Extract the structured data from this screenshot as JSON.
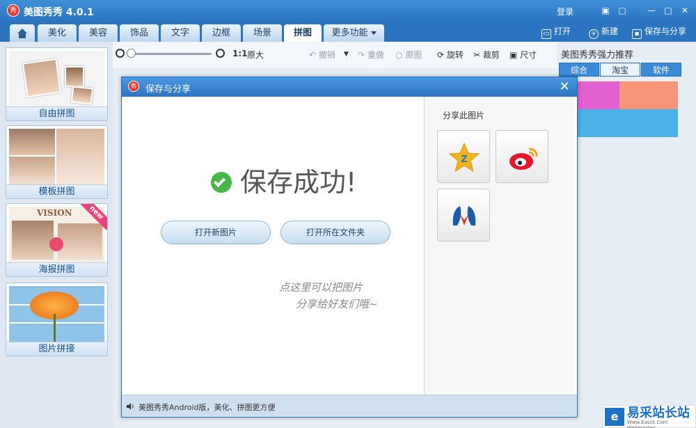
{
  "app": {
    "title": "美图秀秀 4.0.1",
    "logo_char": "秀",
    "login": "登录"
  },
  "tabs": [
    {
      "label": "美化"
    },
    {
      "label": "美容"
    },
    {
      "label": "饰品"
    },
    {
      "label": "文字"
    },
    {
      "label": "边框"
    },
    {
      "label": "场景"
    },
    {
      "label": "拼图",
      "active": true
    },
    {
      "label": "更多功能"
    }
  ],
  "actions": {
    "open": "打开",
    "new": "新建",
    "save_share": "保存与分享"
  },
  "toolbar": {
    "ratio": "1:1",
    "original_size": "原大",
    "undo": "撤销",
    "redo": "重做",
    "original": "原图",
    "rotate": "旋转",
    "crop": "裁剪",
    "size": "尺寸"
  },
  "left_cards": [
    {
      "label": "自由拼图"
    },
    {
      "label": "模板拼图"
    },
    {
      "label": "海报拼图",
      "badge": "new"
    },
    {
      "label": "图片拼接"
    }
  ],
  "recommend": {
    "title": "美图秀秀强力推荐",
    "tabs": [
      "综合",
      "淘宝",
      "软件"
    ]
  },
  "dialog": {
    "title": "保存与分享",
    "logo_char": "秀",
    "success": "保存成功!",
    "open_new": "打开新图片",
    "open_folder": "打开所在文件夹",
    "hint_line1": "点这里可以把图片",
    "hint_line2": "分享给好友们哦~",
    "share_title": "分享此图片",
    "footer": "美图秀秀Android版，美化、拼图更方便"
  },
  "watermark": {
    "logo": "e",
    "text": "易采站长站",
    "sub": "Www.Easck.Com Webmaster"
  },
  "colors": {
    "brand_blue": "#2a74c0",
    "success_green": "#49b64a",
    "logo_red": "#e5352c"
  }
}
